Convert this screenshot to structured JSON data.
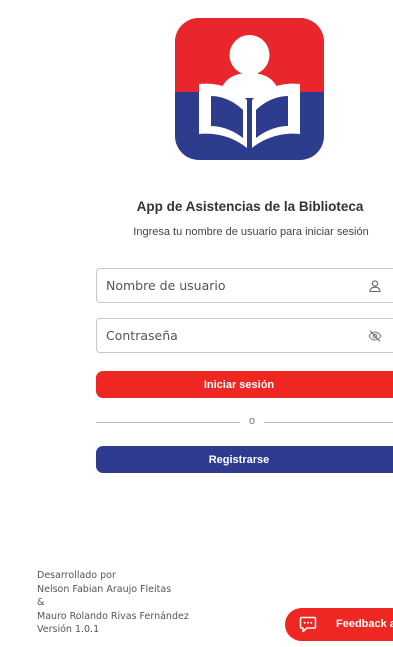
{
  "app": {
    "title": "App de Asistencias de la Biblioteca",
    "subtitle": "Ingresa tu nombre de usuario para iniciar sesión"
  },
  "logo": {
    "icon": "library-reader-icon",
    "colors": {
      "top": "#e8262b",
      "bottom": "#2e3c8e",
      "figure": "#ffffff"
    }
  },
  "form": {
    "username": {
      "placeholder": "Nombre de usuario",
      "value": "",
      "icon": "user-icon"
    },
    "password": {
      "placeholder": "Contraseña",
      "value": "",
      "icon": "eye-off-icon"
    },
    "login_label": "Iniciar sesión",
    "divider_label": "o",
    "register_label": "Registrarse"
  },
  "credits": {
    "line1": "Desarrollado por",
    "line2": "Nelson Fabian Araujo Fleitas",
    "line3": "&",
    "line4": "Mauro Rolando Rivas Fernández",
    "line5": "Versión 1.0.1"
  },
  "feedback": {
    "label": "Feedback a",
    "icon": "chat-bubble-icon"
  },
  "colors": {
    "primary_red": "#ee2722",
    "primary_blue": "#2f3b8f"
  }
}
